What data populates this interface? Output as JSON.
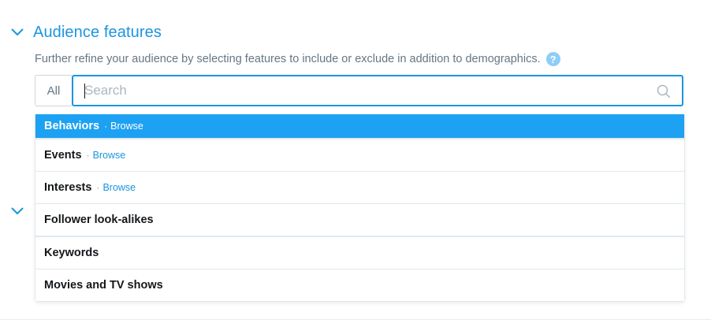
{
  "section": {
    "title": "Audience features",
    "description": "Further refine your audience by selecting features to include or exclude in addition to demographics.",
    "help_icon": "?"
  },
  "search": {
    "scope_label": "All",
    "placeholder": "Search",
    "value": ""
  },
  "dropdown": {
    "browse_label": "Browse",
    "separator": "·",
    "items": [
      {
        "label": "Behaviors",
        "has_browse": true,
        "active": true
      },
      {
        "label": "Events",
        "has_browse": true,
        "active": false
      },
      {
        "label": "Interests",
        "has_browse": true,
        "active": false
      },
      {
        "label": "Follower look-alikes",
        "has_browse": false,
        "active": false
      },
      {
        "label": "Keywords",
        "has_browse": false,
        "active": false
      },
      {
        "label": "Movies and TV shows",
        "has_browse": false,
        "active": false
      }
    ]
  },
  "colors": {
    "accent": "#1b95e0",
    "active_row": "#1da1f2",
    "help_icon_bg": "#8ecdf8"
  },
  "icons": {
    "section_toggle": "chevron-down-icon",
    "help": "help-icon",
    "search": "search-icon"
  }
}
